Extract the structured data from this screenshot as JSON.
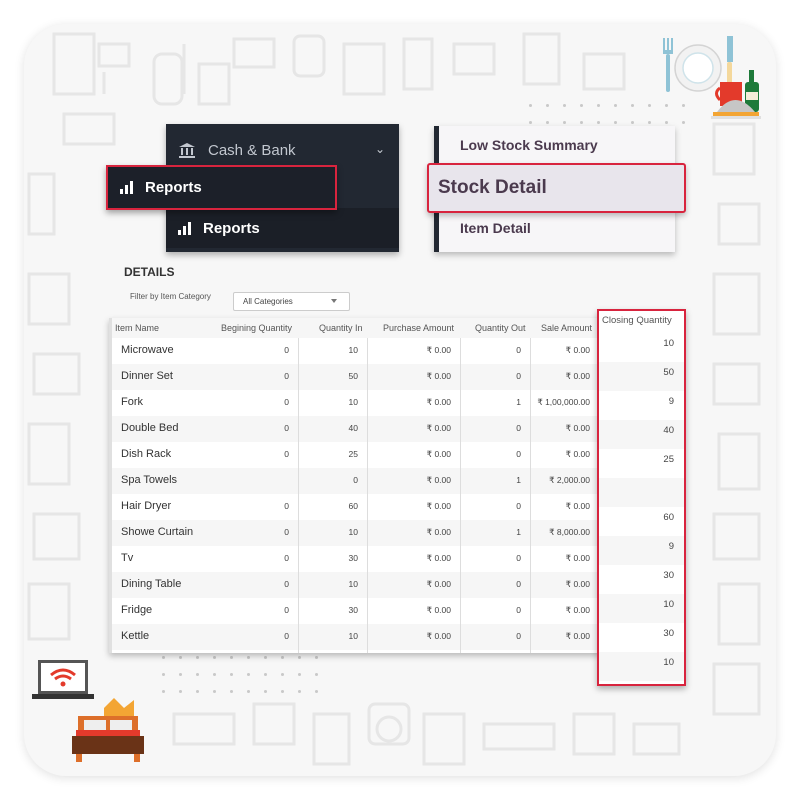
{
  "sidebar": {
    "cash_bank_label": "Cash & Bank",
    "reports_highlight_label": "Reports",
    "reports_label": "Reports",
    "icons": {
      "cash_bank": "bank-icon",
      "expand": "chevron-down-icon",
      "reports": "bar-chart-icon"
    }
  },
  "reports_menu": {
    "low_stock_label": "Low Stock Summary",
    "stock_detail_label": "Stock Detail",
    "item_detail_label": "Item Detail"
  },
  "details": {
    "title": "DETAILS",
    "filter_label": "Filter by Item Category",
    "filter_value": "All Categories"
  },
  "table": {
    "columns": [
      "Item Name",
      "Begining Quantity",
      "Quantity In",
      "Purchase Amount",
      "Quantity Out",
      "Sale Amount",
      "Closing Quantity"
    ],
    "rows": [
      {
        "name": "Microwave",
        "begin": "0",
        "qin": "10",
        "purchase": "₹ 0.00",
        "qout": "0",
        "sale": "₹ 0.00",
        "closing": "10"
      },
      {
        "name": "Dinner Set",
        "begin": "0",
        "qin": "50",
        "purchase": "₹ 0.00",
        "qout": "0",
        "sale": "₹ 0.00",
        "closing": "50"
      },
      {
        "name": "Fork",
        "begin": "0",
        "qin": "10",
        "purchase": "₹ 0.00",
        "qout": "1",
        "sale": "₹ 1,00,000.00",
        "closing": "9"
      },
      {
        "name": "Double Bed",
        "begin": "0",
        "qin": "40",
        "purchase": "₹ 0.00",
        "qout": "0",
        "sale": "₹ 0.00",
        "closing": "40"
      },
      {
        "name": "Dish Rack",
        "begin": "0",
        "qin": "25",
        "purchase": "₹ 0.00",
        "qout": "0",
        "sale": "₹ 0.00",
        "closing": "25"
      },
      {
        "name": "Spa Towels",
        "begin": "",
        "qin": "0",
        "purchase": "₹ 0.00",
        "qout": "1",
        "sale": "₹ 2,000.00",
        "closing": ""
      },
      {
        "name": "Hair Dryer",
        "begin": "0",
        "qin": "60",
        "purchase": "₹ 0.00",
        "qout": "0",
        "sale": "₹ 0.00",
        "closing": "60"
      },
      {
        "name": "Showe Curtain",
        "begin": "0",
        "qin": "10",
        "purchase": "₹ 0.00",
        "qout": "1",
        "sale": "₹ 8,000.00",
        "closing": "9"
      },
      {
        "name": "Tv",
        "begin": "0",
        "qin": "30",
        "purchase": "₹ 0.00",
        "qout": "0",
        "sale": "₹ 0.00",
        "closing": "30"
      },
      {
        "name": "Dining Table",
        "begin": "0",
        "qin": "10",
        "purchase": "₹ 0.00",
        "qout": "0",
        "sale": "₹ 0.00",
        "closing": "10"
      },
      {
        "name": "Fridge",
        "begin": "0",
        "qin": "30",
        "purchase": "₹ 0.00",
        "qout": "0",
        "sale": "₹ 0.00",
        "closing": "30"
      },
      {
        "name": "Kettle",
        "begin": "0",
        "qin": "10",
        "purchase": "₹ 0.00",
        "qout": "0",
        "sale": "₹ 0.00",
        "closing": "10"
      }
    ]
  },
  "colors": {
    "highlight": "#d8243e",
    "dark_panel": "#222832",
    "menu_text": "#4b3a4e"
  },
  "decorations": {
    "top_right": "dining-illustration",
    "bottom_left": "bedroom-illustration"
  }
}
